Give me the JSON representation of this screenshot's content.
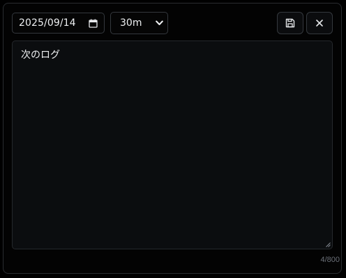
{
  "entry": {
    "date_value": "2025/09/14",
    "duration_value": "30m",
    "text": "次のログ",
    "char_count": "4/800"
  },
  "icons": {
    "date": "calendar-icon",
    "duration": "chevron-down-icon",
    "save": "floppy-disk-icon",
    "close": "close-icon"
  },
  "colors": {
    "background": "#000000",
    "panel_border": "#2a2d31",
    "text": "#eef0f2",
    "muted_text": "#6b7078",
    "editor_bg": "#0b0d0f"
  }
}
